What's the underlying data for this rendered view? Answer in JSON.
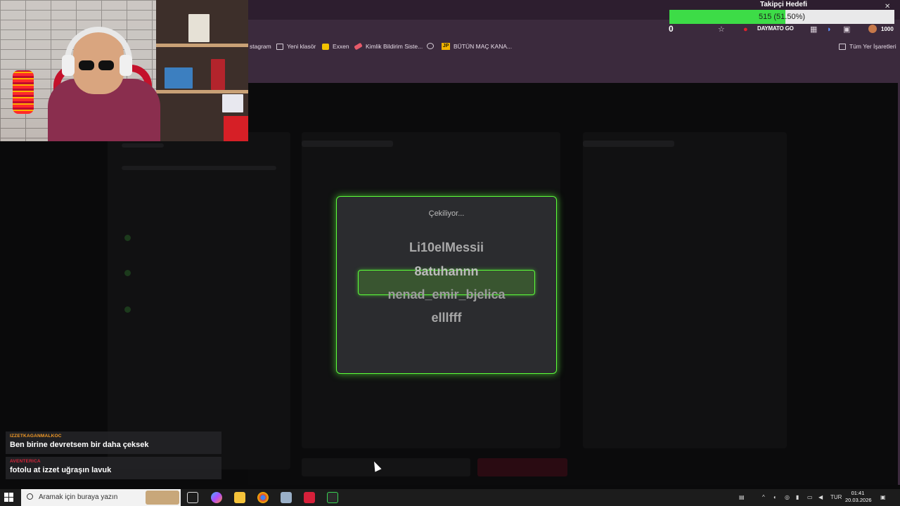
{
  "browser": {
    "bookmarks": [
      {
        "label": "stagram",
        "icon": "instagram-icon"
      },
      {
        "label": "Yeni klasör",
        "icon": "folder-icon"
      },
      {
        "label": "Exxen",
        "icon": "exxen-icon"
      },
      {
        "label": "Kimlik Bildirim Siste...",
        "icon": "kimlik-icon"
      },
      {
        "label": "BÜTÜN MAÇ KANA...",
        "icon": "jp-icon"
      }
    ],
    "all_bookmarks": "Tüm Yer İşaretleri",
    "toolbar_counter": "0",
    "extension_label": "DAYMATO GO",
    "extension_badge": "1000"
  },
  "goal": {
    "title": "Takipçi Hedefi",
    "text": "515 (51.50%)",
    "progress_fraction": 0.515,
    "fill_color": "#3ddc47"
  },
  "modal": {
    "title": "Çekiliyor...",
    "names": [
      "Li10elMessii",
      "8atuhannn",
      "nenad_emir_bjelica",
      "elllfff"
    ],
    "accent_color": "#5cff3a"
  },
  "chat": [
    {
      "user": "IZZETKAGANMALKOC",
      "message": "Ben birine devretsem bir daha çeksek",
      "user_color": "#f29a27"
    },
    {
      "user": "AVENTERICA",
      "message": "fotolu at izzet uğraşın lavuk",
      "user_color": "#d6263a"
    }
  ],
  "taskbar": {
    "search_placeholder": "Aramak için buraya yazın",
    "language": "TUR",
    "time": "01:41",
    "date": "20.03.2026"
  }
}
